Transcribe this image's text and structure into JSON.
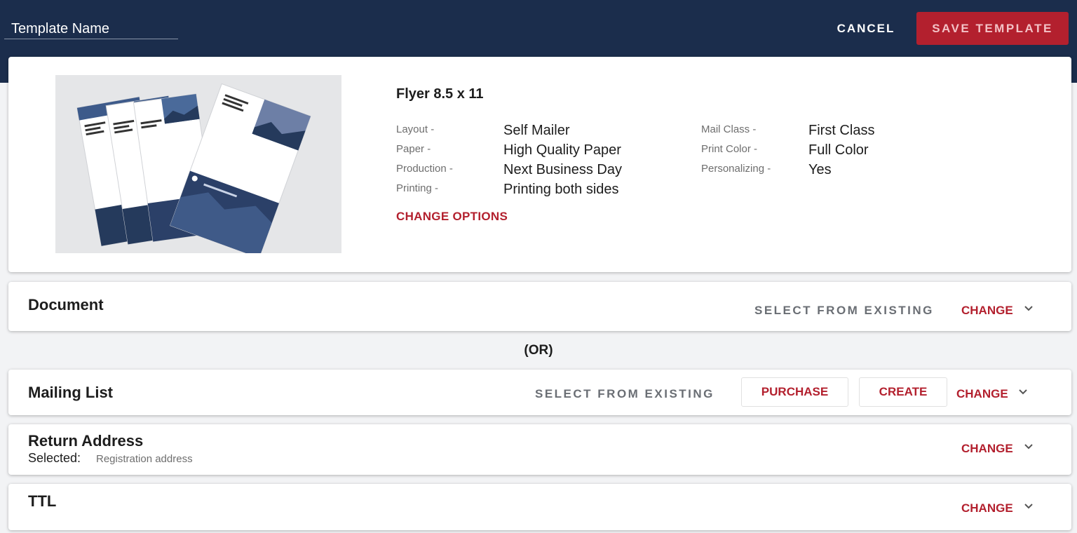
{
  "header": {
    "template_name_placeholder": "Template Name",
    "cancel_label": "CANCEL",
    "save_label": "SAVE TEMPLATE"
  },
  "product": {
    "title": "Flyer 8.5 x 11",
    "options_left": [
      {
        "label": "Layout -",
        "value": "Self Mailer"
      },
      {
        "label": "Paper -",
        "value": "High Quality Paper"
      },
      {
        "label": "Production -",
        "value": "Next Business Day"
      },
      {
        "label": "Printing -",
        "value": "Printing both sides"
      }
    ],
    "options_right": [
      {
        "label": "Mail Class -",
        "value": "First Class"
      },
      {
        "label": "Print Color -",
        "value": "Full Color"
      },
      {
        "label": "Personalizing -",
        "value": "Yes"
      }
    ],
    "change_options_label": "CHANGE OPTIONS"
  },
  "document": {
    "title": "Document",
    "select_existing_label": "SELECT FROM EXISTING",
    "change_label": "CHANGE"
  },
  "or_label": "(OR)",
  "mailing_list": {
    "title": "Mailing List",
    "select_existing_label": "SELECT FROM EXISTING",
    "purchase_label": "PURCHASE",
    "create_label": "CREATE",
    "change_label": "CHANGE"
  },
  "return_address": {
    "title": "Return Address",
    "selected_label": "Selected:",
    "selected_value": "Registration address",
    "change_label": "CHANGE"
  },
  "ttl": {
    "title": "TTL",
    "change_label": "CHANGE"
  },
  "colors": {
    "header_bg": "#1b2d4c",
    "accent_red": "#b3202e",
    "page_bg": "#f2f3f5"
  },
  "icons": [
    "chevron-down-icon",
    "flyer-thumbnail"
  ]
}
